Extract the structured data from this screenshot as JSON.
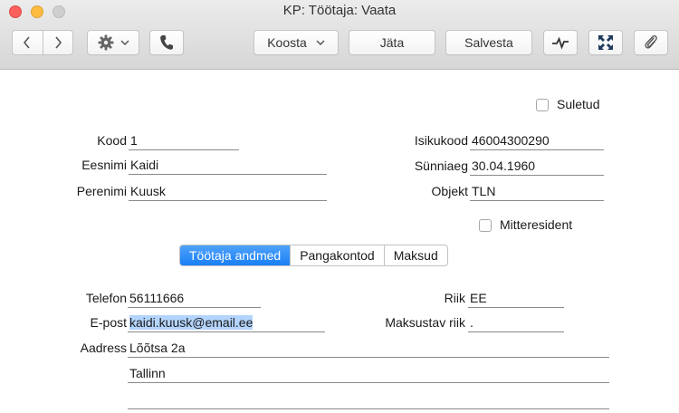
{
  "window": {
    "title": "KP: Töötaja: Vaata"
  },
  "toolbar": {
    "koosta_label": "Koosta",
    "jata_label": "Jäta",
    "salvesta_label": "Salvesta"
  },
  "form": {
    "suletud_label": "Suletud",
    "kood_label": "Kood",
    "kood_value": "1",
    "eesnimi_label": "Eesnimi",
    "eesnimi_value": "Kaidi",
    "perenimi_label": "Perenimi",
    "perenimi_value": "Kuusk",
    "isikukood_label": "Isikukood",
    "isikukood_value": "46004300290",
    "synniaeg_label": "Sünniaeg",
    "synniaeg_value": "30.04.1960",
    "objekt_label": "Objekt",
    "objekt_value": "TLN",
    "mitteresident_label": "Mitteresident"
  },
  "tabs": [
    {
      "label": "Töötaja andmed",
      "active": true
    },
    {
      "label": "Pangakontod",
      "active": false
    },
    {
      "label": "Maksud",
      "active": false
    }
  ],
  "details": {
    "telefon_label": "Telefon",
    "telefon_value": "56111666",
    "epost_label": "E-post",
    "epost_value": "kaidi.kuusk@email.ee",
    "aadress_label": "Aadress",
    "aadress_line1": "Lõõtsa 2a",
    "aadress_line2": "Tallinn",
    "aadress_line3": "",
    "riik_label": "Riik",
    "riik_value": "EE",
    "maksustav_riik_label": "Maksustav riik",
    "maksustav_riik_value": "."
  },
  "colors": {
    "accent": "#1a7ff5",
    "selection": "#b3d4fc"
  }
}
